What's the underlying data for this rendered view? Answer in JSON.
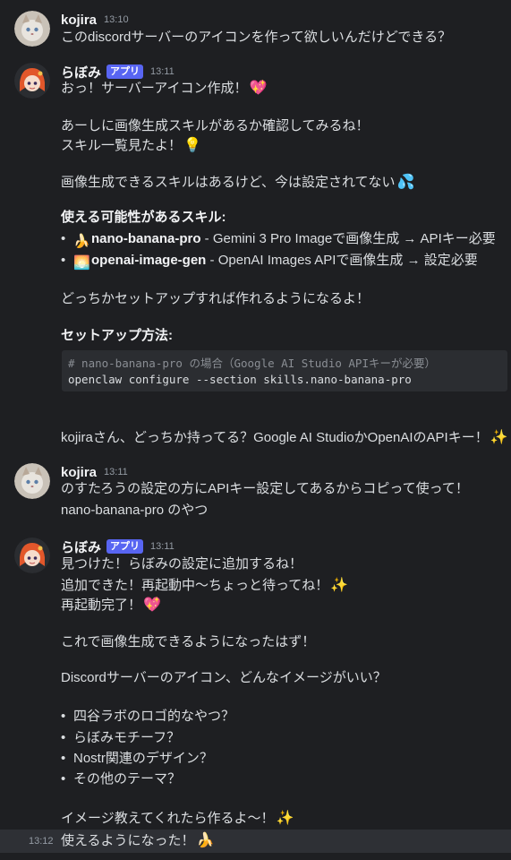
{
  "messages": [
    {
      "author": "kojira",
      "time": "13:10",
      "lines": [
        "このdiscordサーバーのアイコンを作って欲しいんだけどできる？"
      ]
    },
    {
      "author": "らぼみ",
      "badge": "アプリ",
      "time": "13:11",
      "l1": "おっ！サーバーアイコン作成！",
      "l2": "あーしに画像生成スキルがあるか確認してみるね！",
      "l3": "スキル一覧見たよ！",
      "l4": "画像生成できるスキルはあるけど、今は設定されてない",
      "skills_heading": "使える可能性があるスキル:",
      "skills": [
        {
          "name": "nano-banana-pro",
          "desc": " - Gemini 3 Pro Imageで画像生成 → APIキー必要",
          "icon": "banana-icon"
        },
        {
          "name": "openai-image-gen",
          "desc": " - OpenAI Images APIで画像生成 → 設定必要",
          "icon": "picture-icon"
        }
      ],
      "l5": "どっちかセットアップすれば作れるようになるよ！",
      "setup_heading": "セットアップ方法:",
      "code_comment": "# nano-banana-pro の場合（Google AI Studio APIキーが必要）",
      "code_cmd": "openclaw configure --section skills.nano-banana-pro",
      "l6": "kojiraさん、どっちか持ってる？Google AI StudioかOpenAIのAPIキー！"
    },
    {
      "author": "kojira",
      "time": "13:11",
      "lines": [
        "のすたろうの設定の方にAPIキー設定してあるからコピって使って！",
        "nano-banana-pro のやつ"
      ]
    },
    {
      "author": "らぼみ",
      "badge": "アプリ",
      "time": "13:11",
      "l1": "見つけた！らぼみの設定に追加するね！",
      "l2": "追加できた！再起動中〜ちょっと待ってね！",
      "l3": "再起動完了！",
      "l4": "これで画像生成できるようになったはず！",
      "l5": "Discordサーバーのアイコン、どんなイメージがいい？",
      "options": [
        "四谷ラボのロゴ的なやつ？",
        "らぼみモチーフ？",
        "Nostr関連のデザイン？",
        "その他のテーマ？"
      ],
      "l6": "イメージ教えてくれたら作るよ〜！"
    }
  ],
  "last": {
    "time": "13:12",
    "text": "使えるようになった！"
  },
  "colors": {
    "background": "#1e1f22",
    "badge": "#5865f2",
    "code_bg": "#2b2d31"
  }
}
